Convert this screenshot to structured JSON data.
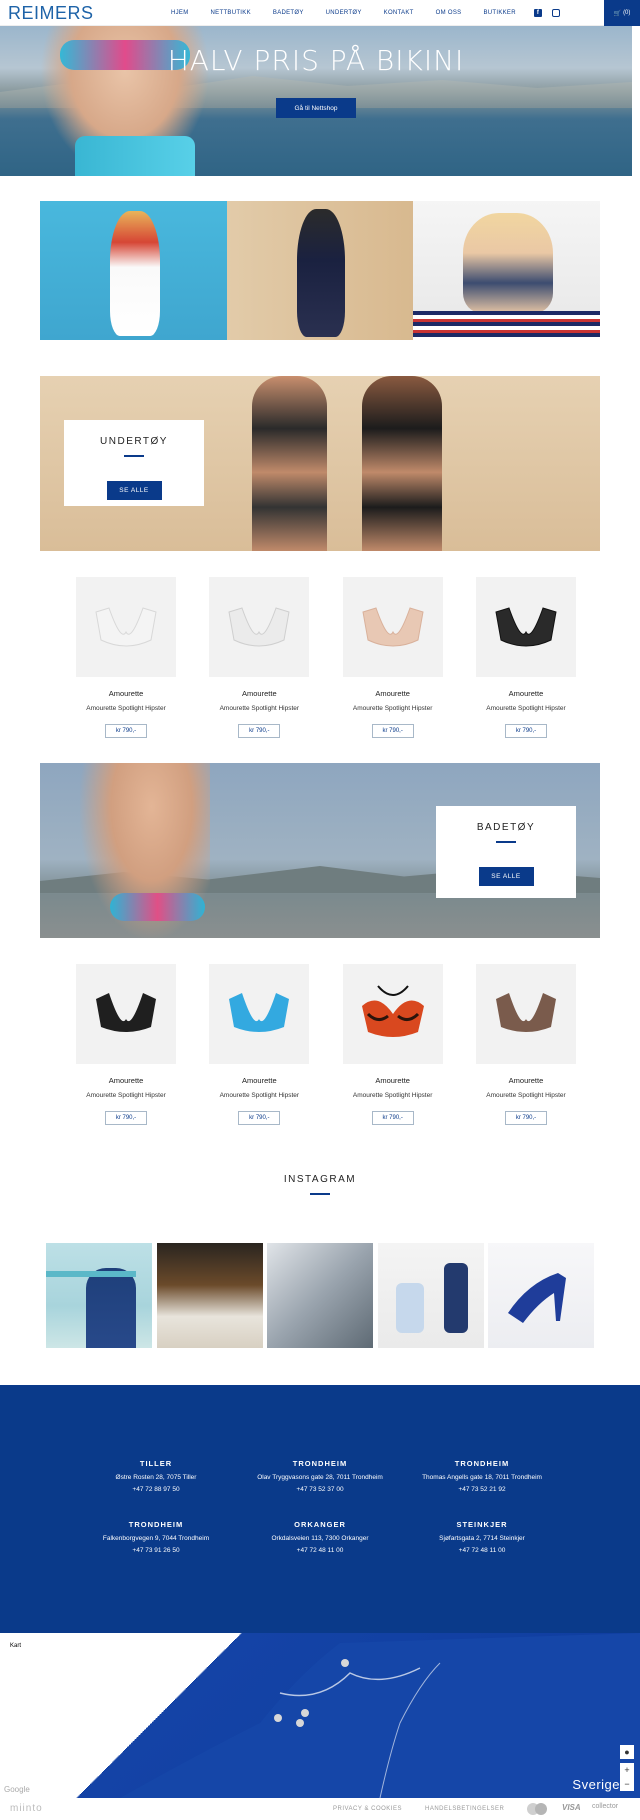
{
  "header": {
    "logo": "REIMERS",
    "nav": [
      "HJEM",
      "NETTBUTIKK",
      "BADETØY",
      "UNDERTØY",
      "KONTAKT",
      "OM OSS",
      "BUTIKKER"
    ],
    "cart_count": "(0)",
    "social": [
      "facebook-icon",
      "instagram-icon"
    ]
  },
  "hero": {
    "title": "HALV PRIS PÅ BIKINI",
    "button_label": "Gå til Nettshop"
  },
  "undertoy": {
    "title": "UNDERTØY",
    "button_label": "SE ALLE",
    "products": [
      {
        "brand": "Amourette",
        "name": "Amourette Spotlight Hipster",
        "price": "kr 790,-",
        "color": "#f4f4f4"
      },
      {
        "brand": "Amourette",
        "name": "Amourette Spotlight Hipster",
        "price": "kr 790,-",
        "color": "#ededed"
      },
      {
        "brand": "Amourette",
        "name": "Amourette Spotlight Hipster",
        "price": "kr 790,-",
        "color": "#e8c8b4"
      },
      {
        "brand": "Amourette",
        "name": "Amourette Spotlight Hipster",
        "price": "kr 790,-",
        "color": "#2a2a2a"
      }
    ]
  },
  "badetoy": {
    "title": "BADETØY",
    "button_label": "SE ALLE",
    "products": [
      {
        "brand": "Amourette",
        "name": "Amourette Spotlight Hipster",
        "price": "kr 790,-",
        "color": "#1f1f1f"
      },
      {
        "brand": "Amourette",
        "name": "Amourette Spotlight Hipster",
        "price": "kr 790,-",
        "color": "#33a9e0"
      },
      {
        "brand": "Amourette",
        "name": "Amourette Spotlight Hipster",
        "price": "kr 790,-",
        "color": "#d9481f"
      },
      {
        "brand": "Amourette",
        "name": "Amourette Spotlight Hipster",
        "price": "kr 790,-",
        "color": "#7a5b4c"
      }
    ]
  },
  "instagram": {
    "title": "INSTAGRAM"
  },
  "stores": [
    {
      "city": "TILLER",
      "address": "Østre Rosten 28, 7075 Tiller",
      "phone": "+47 72 88 97 50"
    },
    {
      "city": "TRONDHEIM",
      "address": "Olav Tryggvasons gate 28, 7011 Trondheim",
      "phone": "+47 73 52 37 00"
    },
    {
      "city": "TRONDHEIM",
      "address": "Thomas Angells gate 18, 7011 Trondheim",
      "phone": "+47 73 52 21 92"
    },
    {
      "city": "TRONDHEIM",
      "address": "Falkenborgvegen 9, 7044 Trondheim",
      "phone": "+47 73 91 26 50"
    },
    {
      "city": "ORKANGER",
      "address": "Orkdalsveien 113, 7300 Orkanger",
      "phone": "+47 72 48 11 00"
    },
    {
      "city": "STEINKJER",
      "address": "Sjøfartsgata 2, 7714 Steinkjer",
      "phone": "+47 72 48 11 00"
    }
  ],
  "map": {
    "label": "Kart",
    "country": "Sverige",
    "provider": "Google"
  },
  "bottom": {
    "logo": "miinto",
    "links": [
      "PRIVACY & COOKIES",
      "HANDELSBETINGELSER"
    ],
    "payments": [
      "VISA",
      "collector"
    ]
  },
  "colors": {
    "brand_blue": "#0a3a8a",
    "logo_blue": "#1e63a8"
  }
}
